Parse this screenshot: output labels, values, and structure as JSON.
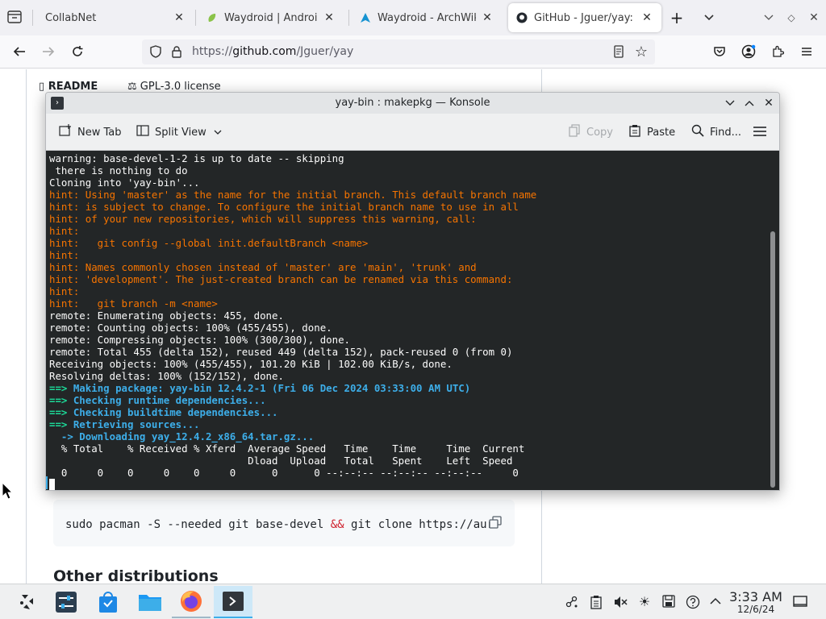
{
  "browser": {
    "tabs": [
      {
        "label": "CollabNet",
        "active": false
      },
      {
        "label": "Waydroid | Android i",
        "active": false
      },
      {
        "label": "Waydroid - ArchWiki",
        "active": false
      },
      {
        "label": "GitHub - Jguer/yay: Y",
        "active": true
      }
    ],
    "new_tab_icon": "plus-icon",
    "url": {
      "prefix": "https://",
      "host": "github.com",
      "path": "/Jguer/yay"
    }
  },
  "page": {
    "readme_label": "README",
    "license_label": "GPL-3.0 license",
    "code": {
      "before": "sudo pacman -S --needed git base-devel ",
      "amp": "&&",
      "after": " git clone https://aur"
    },
    "heading": "Other distributions"
  },
  "konsole": {
    "title": "yay-bin : makepkg — Konsole",
    "toolbar": {
      "new_tab": "New Tab",
      "split_view": "Split View",
      "copy": "Copy",
      "paste": "Paste",
      "find": "Find..."
    },
    "terminal_lines": [
      {
        "text": "warning: base-devel-1-2 is up to date -- skipping",
        "style": ""
      },
      {
        "text": " there is nothing to do",
        "style": ""
      },
      {
        "text": "Cloning into 'yay-bin'...",
        "style": ""
      },
      {
        "text": "hint: Using 'master' as the name for the initial branch. This default branch name",
        "style": "c-hint"
      },
      {
        "text": "hint: is subject to change. To configure the initial branch name to use in all",
        "style": "c-hint"
      },
      {
        "text": "hint: of your new repositories, which will suppress this warning, call:",
        "style": "c-hint"
      },
      {
        "text": "hint:",
        "style": "c-hint"
      },
      {
        "text": "hint:   git config --global init.defaultBranch <name>",
        "style": "c-hint"
      },
      {
        "text": "hint:",
        "style": "c-hint"
      },
      {
        "text": "hint: Names commonly chosen instead of 'master' are 'main', 'trunk' and",
        "style": "c-hint"
      },
      {
        "text": "hint: 'development'. The just-created branch can be renamed via this command:",
        "style": "c-hint"
      },
      {
        "text": "hint:",
        "style": "c-hint"
      },
      {
        "text": "hint:   git branch -m <name>",
        "style": "c-hint"
      },
      {
        "text": "remote: Enumerating objects: 455, done.",
        "style": ""
      },
      {
        "text": "remote: Counting objects: 100% (455/455), done.",
        "style": ""
      },
      {
        "text": "remote: Compressing objects: 100% (300/300), done.",
        "style": ""
      },
      {
        "text": "remote: Total 455 (delta 152), reused 449 (delta 152), pack-reused 0 (from 0)",
        "style": ""
      },
      {
        "text": "Receiving objects: 100% (455/455), 101.20 KiB | 102.00 KiB/s, done.",
        "style": ""
      },
      {
        "text": "Resolving deltas: 100% (152/152), done.",
        "style": ""
      },
      {
        "text": "==> Making package: yay-bin 12.4.2-1 (Fri 06 Dec 2024 03:33:00 AM UTC)",
        "style": "make"
      },
      {
        "text": "==> Checking runtime dependencies...",
        "style": "make"
      },
      {
        "text": "==> Checking buildtime dependencies...",
        "style": "make"
      },
      {
        "text": "==> Retrieving sources...",
        "style": "make"
      },
      {
        "text": "  -> Downloading yay_12.4.2_x86_64.tar.gz...",
        "style": "c-blue"
      },
      {
        "text": "  % Total    % Received % Xferd  Average Speed   Time    Time     Time  Current",
        "style": ""
      },
      {
        "text": "                                 Dload  Upload   Total   Spent    Left  Speed",
        "style": ""
      },
      {
        "text": "  0     0    0     0    0     0      0      0 --:--:-- --:--:-- --:--:--     0",
        "style": ""
      }
    ]
  },
  "taskbar": {
    "clock_time": "3:33 AM",
    "clock_date": "12/6/24"
  },
  "colors": {
    "terminal_bg": "#232627",
    "hint": "#f67400",
    "arrow_green": "#1cdc9a",
    "arrow_blue": "#3daee9",
    "accent": "#3daee9"
  }
}
